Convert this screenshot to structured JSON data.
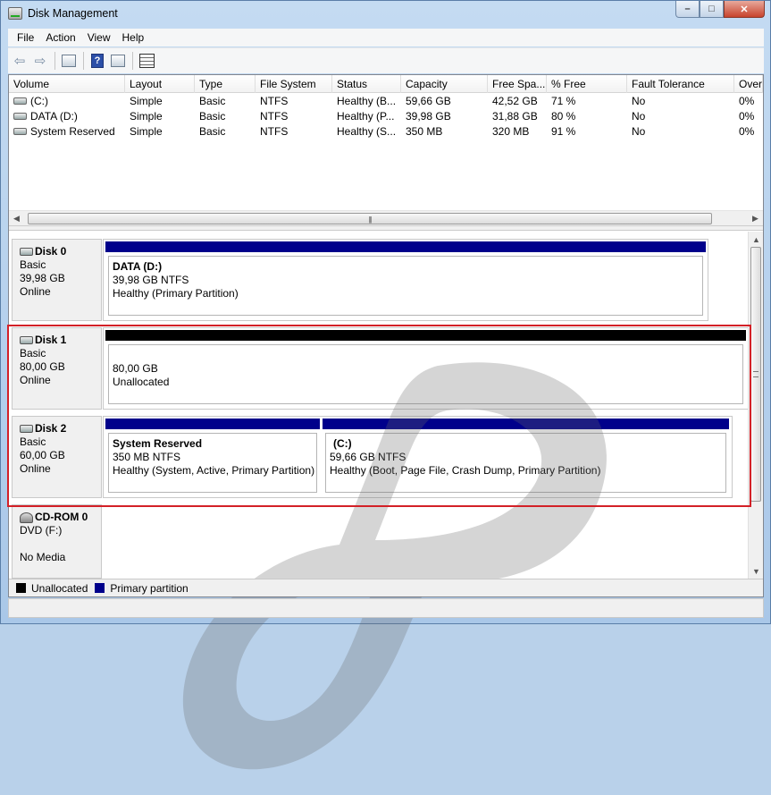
{
  "window": {
    "title": "Disk Management",
    "controls": {
      "minimize": "–",
      "maximize": "□",
      "close": "✕"
    }
  },
  "menu": [
    "File",
    "Action",
    "View",
    "Help"
  ],
  "toolbar": {
    "icons": [
      "back-icon",
      "forward-icon",
      "show-hide-console-tree-icon",
      "help-icon",
      "show-hide-action-pane-icon",
      "properties-icon"
    ],
    "back_glyph": "⇦",
    "forward_glyph": "⇨",
    "help_glyph": "?"
  },
  "volume_list": {
    "columns": [
      "Volume",
      "Layout",
      "Type",
      "File System",
      "Status",
      "Capacity",
      "Free Spa...",
      "% Free",
      "Fault Tolerance",
      "Overl"
    ],
    "rows": [
      {
        "volume": "(C:)",
        "layout": "Simple",
        "type": "Basic",
        "fs": "NTFS",
        "status": "Healthy (B...",
        "capacity": "59,66 GB",
        "free": "42,52 GB",
        "pct_free": "71 %",
        "fault": "No",
        "overhead": "0%"
      },
      {
        "volume": "DATA (D:)",
        "layout": "Simple",
        "type": "Basic",
        "fs": "NTFS",
        "status": "Healthy (P...",
        "capacity": "39,98 GB",
        "free": "31,88 GB",
        "pct_free": "80 %",
        "fault": "No",
        "overhead": "0%"
      },
      {
        "volume": "System Reserved",
        "layout": "Simple",
        "type": "Basic",
        "fs": "NTFS",
        "status": "Healthy (S...",
        "capacity": "350 MB",
        "free": "320 MB",
        "pct_free": "91 %",
        "fault": "No",
        "overhead": "0%"
      }
    ],
    "hscroll": {
      "left": "◀",
      "right": "▶",
      "grip": "|||"
    }
  },
  "disks": [
    {
      "title": "Disk 0",
      "type": "Basic",
      "size": "39,98 GB",
      "state": "Online",
      "partitions": [
        {
          "name": "DATA  (D:)",
          "size_fs": "39,98 GB NTFS",
          "status": "Healthy (Primary Partition)"
        }
      ]
    },
    {
      "title": "Disk 1",
      "type": "Basic",
      "size": "80,00 GB",
      "state": "Online",
      "partitions": [
        {
          "name": "",
          "size_fs": "80,00 GB",
          "status": "Unallocated"
        }
      ]
    },
    {
      "title": "Disk 2",
      "type": "Basic",
      "size": "60,00 GB",
      "state": "Online",
      "partitions": [
        {
          "name": "System Reserved",
          "size_fs": "350 MB NTFS",
          "status": "Healthy (System, Active, Primary Partition)"
        },
        {
          "name": "(C:)",
          "size_fs": "59,66 GB NTFS",
          "status": "Healthy (Boot, Page File, Crash Dump, Primary Partition)"
        }
      ]
    },
    {
      "title": "CD-ROM 0",
      "type": "DVD (F:)",
      "size": "",
      "state": "No Media",
      "partitions": []
    }
  ],
  "vscroll": {
    "up": "▲",
    "down": "▼"
  },
  "legend": [
    {
      "label": "Unallocated",
      "color": "#000000"
    },
    {
      "label": "Primary partition",
      "color": "#00008b"
    }
  ],
  "colors": {
    "primary_partition": "#00008b",
    "unallocated": "#000000",
    "highlight_box": "#d32027"
  }
}
